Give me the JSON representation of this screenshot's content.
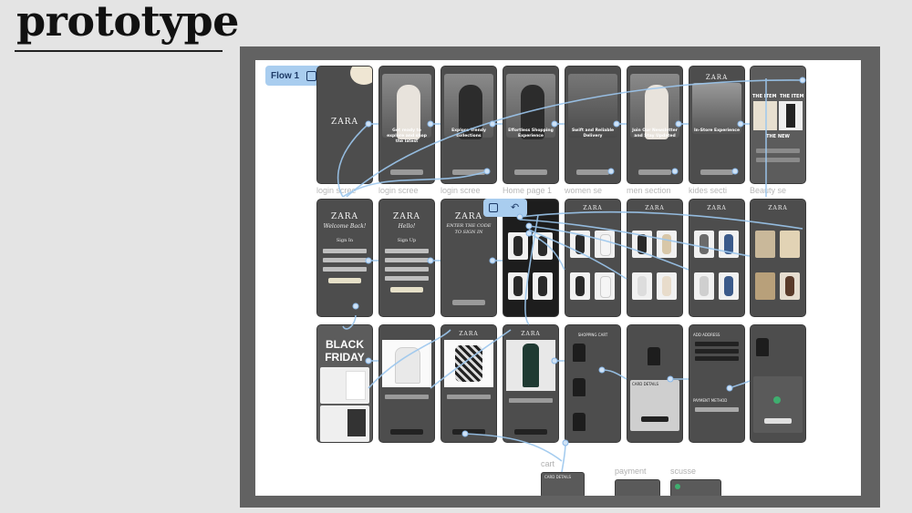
{
  "page": {
    "title": "prototype"
  },
  "flow": {
    "label": "Flow 1"
  },
  "row1_labels": [
    "login scree",
    "login scree",
    "login scree",
    "Home page 1",
    "women se",
    "men section",
    "kides secti",
    "Beauty se"
  ],
  "onboarding": [
    {
      "text": ""
    },
    {
      "text": "Get ready to explore and shop the latest"
    },
    {
      "text": "Explore Trendy collections"
    },
    {
      "text": "Effortless Shopping Experience"
    },
    {
      "text": "Swift and Reliable Delivery"
    },
    {
      "text": "Join Our Newsletter and Stay Updated"
    },
    {
      "text": "In-Store Experience"
    },
    {
      "text": "THE NEW"
    }
  ],
  "brand": {
    "logo": "ZARA"
  },
  "auth": {
    "welcome": "Welcome Back!",
    "signin": "Sign In",
    "hello": "Hello!",
    "signup": "Sign Up",
    "code": "ENTER THE CODE TO SIGN IN"
  },
  "promo": {
    "headline_1": "BLACK",
    "headline_2": "FRIDAY"
  },
  "cart": {
    "title": "SHOPPING CART",
    "card_title": "CARD DETAILS",
    "address": "ADD ADDRESS",
    "payment": "PAYMENT METHOD"
  },
  "bottom_labels": {
    "cart": "cart",
    "payment": "payment",
    "success": "scusse"
  },
  "beauty": {
    "item_title": "THE ITEM"
  }
}
